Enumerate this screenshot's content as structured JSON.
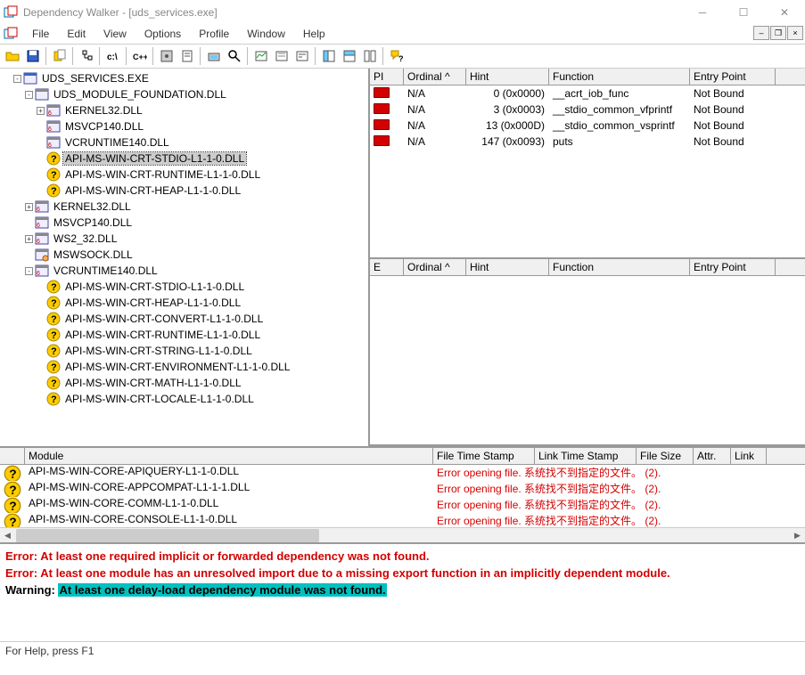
{
  "window": {
    "title": "Dependency Walker - [uds_services.exe]"
  },
  "menus": [
    "File",
    "Edit",
    "View",
    "Options",
    "Profile",
    "Window",
    "Help"
  ],
  "tree": [
    {
      "lvl": 0,
      "pm": "-",
      "icon": "exe",
      "label": "UDS_SERVICES.EXE"
    },
    {
      "lvl": 1,
      "pm": "-",
      "icon": "dll",
      "label": "UDS_MODULE_FOUNDATION.DLL"
    },
    {
      "lvl": 2,
      "pm": "+",
      "icon": "dll6",
      "label": "KERNEL32.DLL"
    },
    {
      "lvl": 2,
      "pm": "",
      "icon": "dll6",
      "label": "MSVCP140.DLL"
    },
    {
      "lvl": 2,
      "pm": "",
      "icon": "dll6",
      "label": "VCRUNTIME140.DLL"
    },
    {
      "lvl": 2,
      "pm": "",
      "icon": "q",
      "label": "API-MS-WIN-CRT-STDIO-L1-1-0.DLL",
      "sel": true
    },
    {
      "lvl": 2,
      "pm": "",
      "icon": "q",
      "label": "API-MS-WIN-CRT-RUNTIME-L1-1-0.DLL"
    },
    {
      "lvl": 2,
      "pm": "",
      "icon": "q",
      "label": "API-MS-WIN-CRT-HEAP-L1-1-0.DLL"
    },
    {
      "lvl": 1,
      "pm": "+",
      "icon": "dll6",
      "label": "KERNEL32.DLL"
    },
    {
      "lvl": 1,
      "pm": "",
      "icon": "dll6",
      "label": "MSVCP140.DLL"
    },
    {
      "lvl": 1,
      "pm": "+",
      "icon": "dll6",
      "label": "WS2_32.DLL"
    },
    {
      "lvl": 1,
      "pm": "",
      "icon": "dlld",
      "label": "MSWSOCK.DLL"
    },
    {
      "lvl": 1,
      "pm": "-",
      "icon": "dll6",
      "label": "VCRUNTIME140.DLL"
    },
    {
      "lvl": 2,
      "pm": "",
      "icon": "q",
      "label": "API-MS-WIN-CRT-STDIO-L1-1-0.DLL"
    },
    {
      "lvl": 2,
      "pm": "",
      "icon": "q",
      "label": "API-MS-WIN-CRT-HEAP-L1-1-0.DLL"
    },
    {
      "lvl": 2,
      "pm": "",
      "icon": "q",
      "label": "API-MS-WIN-CRT-CONVERT-L1-1-0.DLL"
    },
    {
      "lvl": 2,
      "pm": "",
      "icon": "q",
      "label": "API-MS-WIN-CRT-RUNTIME-L1-1-0.DLL"
    },
    {
      "lvl": 2,
      "pm": "",
      "icon": "q",
      "label": "API-MS-WIN-CRT-STRING-L1-1-0.DLL"
    },
    {
      "lvl": 2,
      "pm": "",
      "icon": "q",
      "label": "API-MS-WIN-CRT-ENVIRONMENT-L1-1-0.DLL"
    },
    {
      "lvl": 2,
      "pm": "",
      "icon": "q",
      "label": "API-MS-WIN-CRT-MATH-L1-1-0.DLL"
    },
    {
      "lvl": 2,
      "pm": "",
      "icon": "q",
      "label": "API-MS-WIN-CRT-LOCALE-L1-1-0.DLL"
    }
  ],
  "imports": {
    "headers": [
      "PI",
      "Ordinal ^",
      "Hint",
      "Function",
      "Entry Point"
    ],
    "rows": [
      {
        "ord": "N/A",
        "hint": "0 (0x0000)",
        "fn": "__acrt_iob_func",
        "ep": "Not Bound"
      },
      {
        "ord": "N/A",
        "hint": "3 (0x0003)",
        "fn": "__stdio_common_vfprintf",
        "ep": "Not Bound"
      },
      {
        "ord": "N/A",
        "hint": "13 (0x000D)",
        "fn": "__stdio_common_vsprintf",
        "ep": "Not Bound"
      },
      {
        "ord": "N/A",
        "hint": "147 (0x0093)",
        "fn": "puts",
        "ep": "Not Bound"
      }
    ]
  },
  "exports": {
    "headers": [
      "E",
      "Ordinal ^",
      "Hint",
      "Function",
      "Entry Point"
    ]
  },
  "modules": {
    "headers": [
      "",
      "Module",
      "File Time Stamp",
      "Link Time Stamp",
      "File Size",
      "Attr.",
      "Link"
    ],
    "err_text": "Error opening file. 系统找不到指定的文件。 (2).",
    "rows": [
      "API-MS-WIN-CORE-APIQUERY-L1-1-0.DLL",
      "API-MS-WIN-CORE-APPCOMPAT-L1-1-1.DLL",
      "API-MS-WIN-CORE-COMM-L1-1-0.DLL",
      "API-MS-WIN-CORE-CONSOLE-L1-1-0.DLL"
    ]
  },
  "log": {
    "err1": "Error: At least one required implicit or forwarded dependency was not found.",
    "err2": "Error: At least one module has an unresolved import due to a missing export function in an implicitly dependent module.",
    "warn_label": "Warning: ",
    "warn_hl": "At least one delay-load dependency module was not found."
  },
  "status": "For Help, press F1"
}
